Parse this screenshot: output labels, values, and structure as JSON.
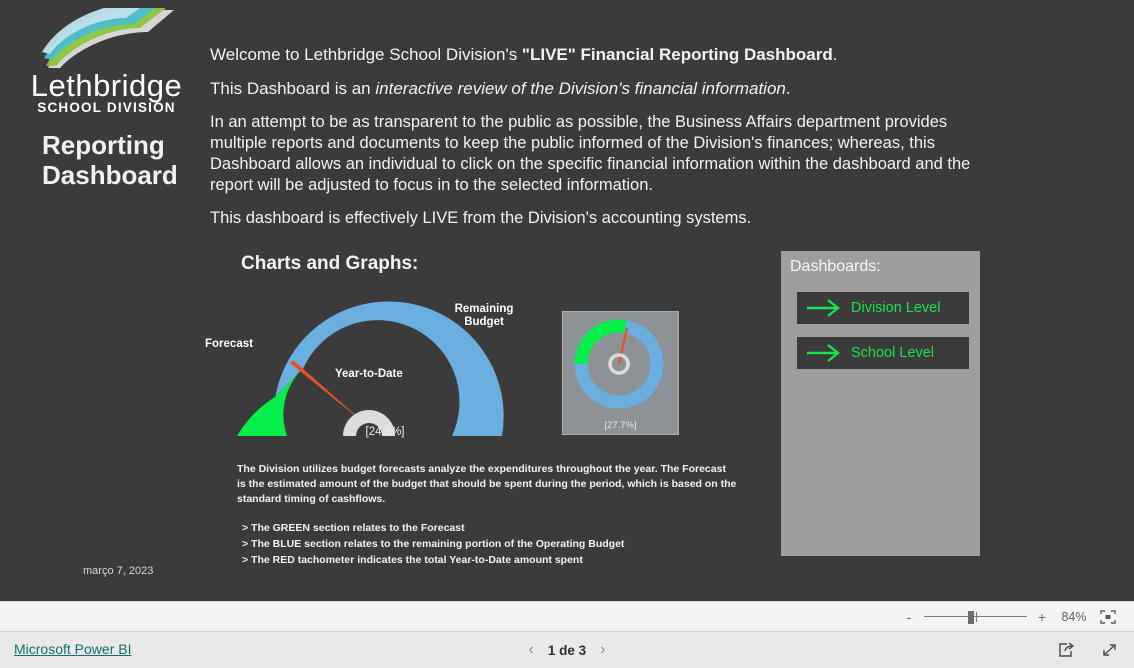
{
  "brand": {
    "logo_icon": "lethbridge-swoosh-logo",
    "name": "Lethbridge",
    "subtitle": "SCHOOL DIVISION",
    "report_title": "Reporting\nDashboard",
    "report_title_line1": "Reporting",
    "report_title_line2": "Dashboard",
    "date": "março 7, 2023"
  },
  "intro": {
    "p1_before": "Welcome to Lethbridge School Division's ",
    "p1_bold": "\"LIVE\" Financial Reporting Dashboard",
    "p1_after": ".",
    "p2_before": "This Dashboard is an ",
    "p2_italic": "interactive review of the Division's financial information",
    "p2_after": ".",
    "p3": "In an attempt to be as transparent to the public as possible, the Business Affairs department provides multiple reports and documents to keep the public informed of the Division's finances; whereas, this Dashboard allows an individual to click on the specific financial information within the dashboard and the report will be adjusted to focus in to the selected information.",
    "p4": "This dashboard is effectively LIVE from the Division's accounting systems."
  },
  "charts": {
    "heading": "Charts and Graphs:"
  },
  "chart_data": [
    {
      "type": "gauge",
      "name": "budget-forecast-gauge",
      "title": "",
      "value_label": "[24.8%]",
      "value": 24.8,
      "min": 0,
      "max": 100,
      "needle_value": 24.8,
      "segments": [
        {
          "name": "Forecast",
          "from": 0,
          "to": 19.5,
          "color": "#05EF4B"
        },
        {
          "name": "Remaining Budget",
          "from": 19.5,
          "to": 100,
          "color": "#6BAFE0"
        }
      ],
      "annotations": [
        {
          "text": "Forecast",
          "position": "left"
        },
        {
          "text": "Remaining\nBudget",
          "position": "top-right",
          "line1": "Remaining",
          "line2": "Budget"
        },
        {
          "text": "Year-to-Date",
          "position": "center"
        }
      ],
      "needle_color": "#E8502A",
      "hub_color": "#DCDCDC"
    },
    {
      "type": "gauge",
      "name": "mini-budget-gauge",
      "value_label": "[27.7%]",
      "value": 27.7,
      "min": 0,
      "max": 100,
      "needle_value": 27.7,
      "segments": [
        {
          "name": "Forecast",
          "from": 0,
          "to": 27.7,
          "color": "#05EF4B"
        },
        {
          "name": "Remaining Budget",
          "from": 27.7,
          "to": 100,
          "color": "#6BAFE0"
        }
      ],
      "needle_color": "#E8502A",
      "hub_color": "#DCDCDC",
      "card_background": "#8D9296"
    }
  ],
  "explain": {
    "paragraph": "The Division utilizes budget forecasts analyze the expenditures throughout the year.  The Forecast is the estimated amount of the budget that should be spent during the period, which is based on the standard timing of cashflows.",
    "bullets": [
      "> The GREEN section relates to the Forecast",
      "> The BLUE section relates to the remaining portion of the Operating Budget",
      "> The RED tachometer indicates the total Year-to-Date amount spent"
    ]
  },
  "dashboards": {
    "title": "Dashboards:",
    "buttons": [
      {
        "label": "Division Level",
        "icon": "arrow-right-icon"
      },
      {
        "label": "School Level",
        "icon": "arrow-right-icon"
      }
    ]
  },
  "zoombar": {
    "minus": "-",
    "plus": "+",
    "percent": "84%",
    "fit_icon": "fit-to-page-icon"
  },
  "footer": {
    "powerbi_link": "Microsoft Power BI",
    "prev_icon": "chevron-left-icon",
    "next_icon": "chevron-right-icon",
    "page_label": "1 de 3",
    "share_icon": "share-icon",
    "fullscreen_icon": "fullscreen-icon"
  },
  "colors": {
    "canvas_bg": "#3B3B3B",
    "green": "#05EF4B",
    "blue": "#6BAFE0",
    "red": "#E8502A",
    "panel_gray": "#9E9E9E",
    "link_teal": "#11706E"
  }
}
